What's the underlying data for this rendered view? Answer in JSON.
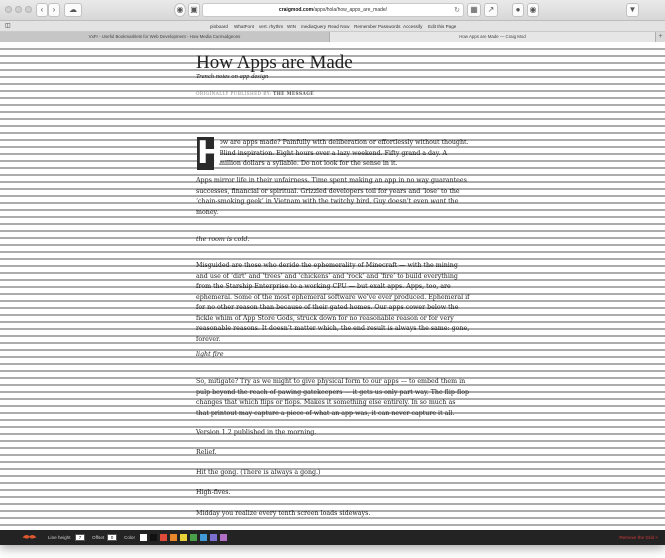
{
  "browser": {
    "url_host": "craigmod.com",
    "url_path": "/apps/hola/how_apps_are_made/",
    "bookmarks": [
      "pinboard",
      "WhatFont",
      "vert. rhythm",
      "WIN",
      "mediaQuery",
      "Read Now",
      "Remember Passwords",
      "Accessify",
      "Edit this Page"
    ],
    "tabs": [
      {
        "label": "VxFr - Useful Bookmarklets for Web Development - How Media Curmudgeons"
      },
      {
        "label": "How Apps are Made — Craig Mod"
      }
    ],
    "new_tab": "+"
  },
  "article": {
    "title": "How Apps are Made",
    "subtitle": "Trench notes on app design",
    "published_prefix": "ORIGINALLY PUBLISHED BY:",
    "published_source": "THE MESSAGE",
    "dropcap": "H",
    "para1": "ow are apps made? Painfully with deliberation or effortlessly without thought. Blind inspiration. Eight hours over a lazy weekend. Fifty grand a day. A million dollars a syllable. Do not look for the sense in it.",
    "para2a": "Apps mirror life in their unfairness. Time spent making an app in no way guarantees successes, financial or spiritual. Grizzled developers toil for years and ‘lose’ to the ‘chain-smoking geek’ in Vietnam with the twitchy bird. Guy doesn’t even ",
    "para2_em": "want",
    "para2b": " the money.",
    "h1": "the room is cold.",
    "para3": "Misguided are those who deride the ephemerality of Minecraft — with the mining and use of ‘dirt’ and ‘trees’ and ‘chickens’ and ‘rock’ and ‘fire’ to build everything from the Starship Enterprise to a working CPU — but exalt apps. Apps, too, are ephemeral. Some of the most ephemeral software we’ve ever produced. Ephemeral if for no other reason than because of their gated homes. Our apps cower below the fickle whim of App Store Gods, struck down for no reasonable reason or for very reasonable reasons. It doesn’t matter which, the end result is always the same: gone, forever.",
    "h2": "light fire",
    "para4": "So, mitigate? Try as we might to give physical form to our apps — to embed them in pulp beyond the reach of pawing gatekeepers — it gets us only part way. The flip-flop changes that which flips or flops. Makes it something else entirely. In so much as that printout may capture a piece of what an app was, it can never capture it all.",
    "line1": "Version 1.2 published in the morning.",
    "line2": "Relief.",
    "line3": "Hit the gong. (There is always a gong.)",
    "line4": "High-fives.",
    "line5": "Midday you realize every tenth screen loads sideways."
  },
  "grid_tool": {
    "line_height_label": "Line height",
    "line_height_value": "7",
    "offset_label": "Offset",
    "offset_value": "0",
    "color_label": "Color",
    "swatches": [
      "#ffffff",
      "#111111",
      "#e04a3a",
      "#e8872b",
      "#e8d23a",
      "#4aa14a",
      "#3f9ad6",
      "#7b6fd0",
      "#b06fc4"
    ],
    "remove_label": "Remove the Grid ×"
  }
}
